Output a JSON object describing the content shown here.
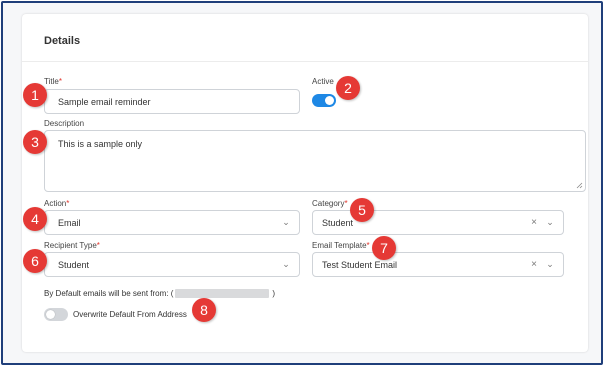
{
  "section": {
    "title": "Details"
  },
  "title_field": {
    "label": "Title",
    "value": "Sample email reminder"
  },
  "active": {
    "label": "Active",
    "on": true
  },
  "description": {
    "label": "Description",
    "value": "This is a sample only"
  },
  "action": {
    "label": "Action",
    "value": "Email"
  },
  "category": {
    "label": "Category",
    "value": "Student"
  },
  "recipient_type": {
    "label": "Recipient Type",
    "value": "Student"
  },
  "email_template": {
    "label": "Email Template",
    "value": "Test Student Email"
  },
  "from_address": {
    "prefix": "By Default emails will be sent from: (",
    "suffix": ")"
  },
  "overwrite": {
    "label": "Overwrite Default From Address",
    "on": false
  },
  "required_mark": "*",
  "icons": {
    "chevron": "chevron-down-icon",
    "clear": "clear-icon"
  },
  "markers": [
    "1",
    "2",
    "3",
    "4",
    "5",
    "6",
    "7",
    "8"
  ],
  "colors": {
    "accent": "#1e88e5",
    "marker": "#e53935",
    "frame": "#1f3e7a",
    "required": "#e2332a"
  }
}
